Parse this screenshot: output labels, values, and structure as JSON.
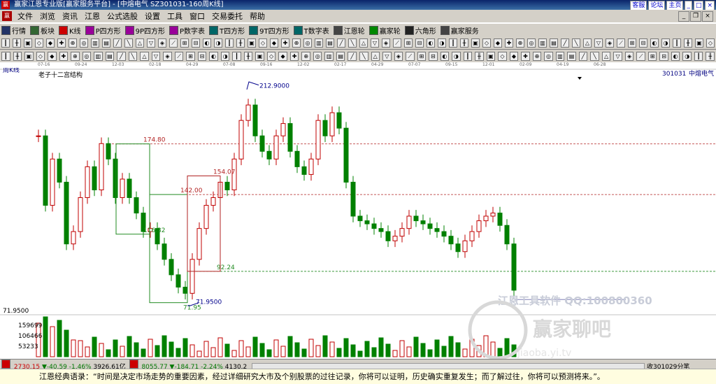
{
  "window": {
    "title": "赢家江恩专业版[赢家服务平台] - [中熔电气  SZ301031-160周K线]",
    "top_links": [
      "客服",
      "论坛",
      "主页"
    ]
  },
  "menu": [
    "文件",
    "浏览",
    "资讯",
    "江恩",
    "公式选股",
    "设置",
    "工具",
    "窗口",
    "交易委托",
    "帮助"
  ],
  "toolbar": [
    {
      "label": "行情",
      "icon": "grid-icon"
    },
    {
      "label": "板块",
      "icon": "blocks-icon"
    },
    {
      "label": "K线",
      "icon": "kline-icon"
    },
    {
      "label": "P四方形",
      "icon": "p-square-icon"
    },
    {
      "label": "9P四方形",
      "icon": "9p-square-icon"
    },
    {
      "label": "P数字表",
      "icon": "p-table-icon"
    },
    {
      "label": "T四方形",
      "icon": "t-square-icon"
    },
    {
      "label": "9T四方形",
      "icon": "9t-square-icon"
    },
    {
      "label": "T数字表",
      "icon": "t-table-icon"
    },
    {
      "label": "江恩轮",
      "icon": "gann-wheel-icon"
    },
    {
      "label": "赢家轮",
      "icon": "winner-wheel-icon"
    },
    {
      "label": "六角形",
      "icon": "hexagon-icon"
    },
    {
      "label": "赢家服务",
      "icon": "service-icon"
    }
  ],
  "chart": {
    "period_label": "周K线",
    "study_title": "老子十二宫结构",
    "stock_code": "301031",
    "stock_name": "中熔电气",
    "date_ticks": [
      "07-16",
      "09-24",
      "12-03",
      "02-18",
      "04-29",
      "07-08",
      "09-16",
      "12-02",
      "02-17",
      "04-29",
      "07-07",
      "09-15",
      "12-01",
      "02-09",
      "04-19",
      "06-28"
    ],
    "price_levels": [
      {
        "value": "212.9000",
        "color": "#00008b"
      },
      {
        "value": "174.80",
        "color": "#b22222"
      },
      {
        "value": "154.07",
        "color": "#b22222"
      },
      {
        "value": "142.00",
        "color": "#b22222"
      },
      {
        "value": "116.32",
        "color": "#228b22"
      },
      {
        "value": "92.24",
        "color": "#228b22"
      },
      {
        "value": "71.9500",
        "color": "#00008b"
      },
      {
        "value": "71.95",
        "color": "#228b22"
      }
    ],
    "left_price_label": "71.9500",
    "volume_labels": [
      "159699",
      "106466",
      "53233"
    ],
    "watermark": {
      "line1": "江恩工具软件  QQ:100800360",
      "line2": "赢家聊吧",
      "url": "jiaoba.yi.tv"
    }
  },
  "status": {
    "sh_index": "2730.15",
    "sh_change": "▼-40.59 -1.46%",
    "sh_amount": "3926.61亿",
    "sz_index": "8055.77",
    "sz_change": "▼-184.71 -2.24%",
    "sz_amount": "4130.2",
    "received": "收301029分笔"
  },
  "quote": {
    "text": "江恩经典语录：“时间是决定市场走势的重要因素，经过详细研究大市及个别股票的过往记录，你将可以证明，历史确实重复发生；而了解过往，你将可以预测将来。”。"
  },
  "colors": {
    "up": "#c00000",
    "down": "#008000",
    "title_bar": "#0a246a"
  }
}
